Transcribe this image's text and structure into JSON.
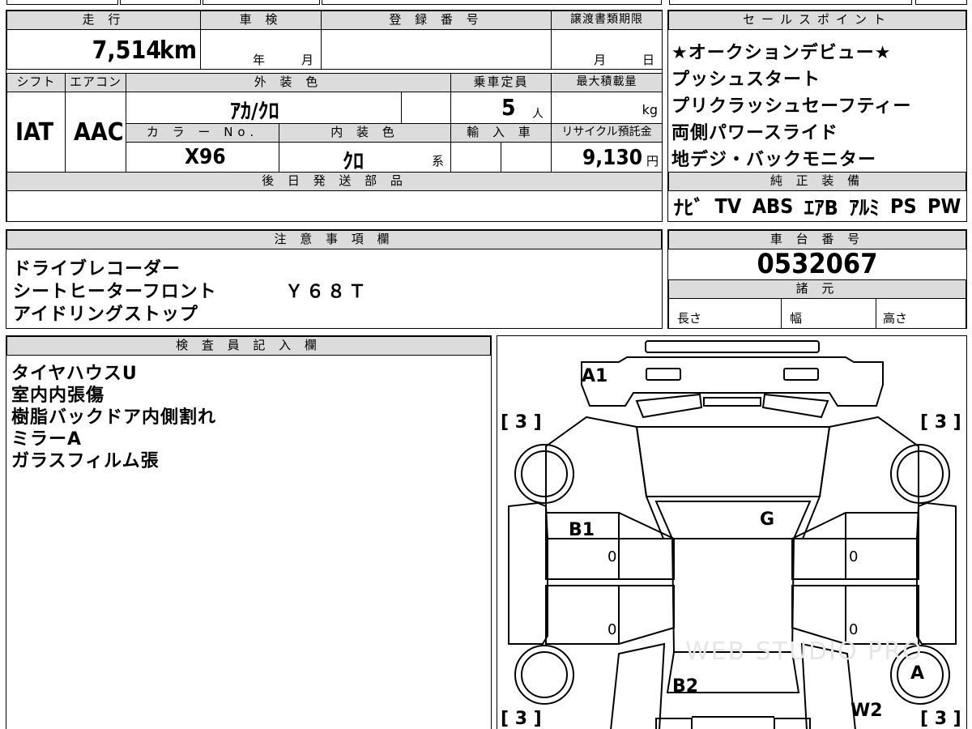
{
  "top_sheet": {
    "mileage": {
      "label": "走 行",
      "value": "7,514",
      "unit": "km"
    },
    "inspection": {
      "label": "車 検",
      "year_unit": "年",
      "month_unit": "月"
    },
    "registration": {
      "label": "登 録 番 号"
    },
    "transfer_deadline": {
      "label": "譲渡書類期限",
      "month_unit": "月",
      "day_unit": "日"
    },
    "shift": {
      "label": "シフト",
      "value": "IAT"
    },
    "aircon": {
      "label": "エアコン",
      "value": "AAC"
    },
    "exterior_color": {
      "label": "外 装 色",
      "value": "ｱｶ/ｸﾛ"
    },
    "capacity": {
      "label": "乗車定員",
      "value": "5",
      "unit": "人"
    },
    "max_load": {
      "label": "最大積載量",
      "unit": "kg"
    },
    "color_no": {
      "label": "カ ラ ー No.",
      "value": "X96"
    },
    "interior_color": {
      "label": "内 装 色",
      "value": "ｸﾛ",
      "unit": "系"
    },
    "import": {
      "label": "輸 入 車"
    },
    "recycle_fee": {
      "label": "リサイクル預託金",
      "value": "9,130",
      "unit": "円"
    },
    "later_parts": {
      "label": "後 日 発 送 部 品"
    }
  },
  "sales_points": {
    "label": "セールスポイント",
    "items": [
      "★オークションデビュー★",
      "プッシュスタート",
      "プリクラッシュセーフティー",
      "両側パワースライド",
      "地デジ・バックモニター"
    ]
  },
  "genuine_equipment": {
    "label": "純 正 装 備",
    "items": [
      "ﾅﾋﾞ",
      "TV",
      "ABS",
      "ｴｱB",
      "ｱﾙﾐ",
      "PS",
      "PW"
    ]
  },
  "notes": {
    "label": "注 意 事 項 欄",
    "lines": [
      "ドライブレコーダー",
      "シートヒーターフロント",
      "アイドリングストップ"
    ],
    "code": "Ｙ６８Ｔ"
  },
  "chassis": {
    "label": "車 台 番 号",
    "value": "0532067"
  },
  "specs": {
    "label": "諸 元",
    "length": "長さ",
    "width": "幅",
    "height": "高さ"
  },
  "inspector": {
    "label": "検 査 員 記 入 欄",
    "lines": [
      "タイヤハウスU",
      "室内内張傷",
      "樹脂バックドア内側割れ",
      "ミラーA",
      "ガラスフィルム張"
    ]
  },
  "diagram": {
    "marks": {
      "a1": "A1",
      "b1": "B1",
      "g": "G",
      "b2": "B2",
      "a": "A",
      "w2": "W2",
      "tire_fl": "[ 3 ]",
      "tire_fr": "[ 3 ]",
      "tire_rl": "[ 3 ]",
      "tire_rr": "[ 3 ]",
      "zero_1": "0",
      "zero_2": "0",
      "zero_3": "0",
      "zero_4": "0"
    },
    "watermark": "WEB STUDIO PRO"
  }
}
